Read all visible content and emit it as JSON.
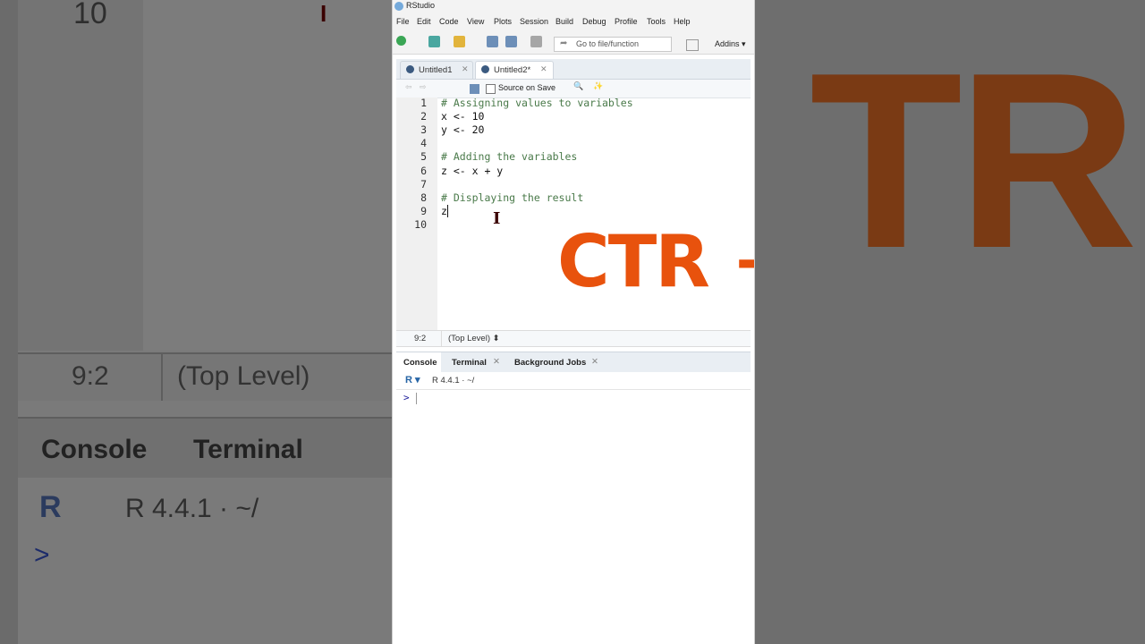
{
  "window": {
    "title": "RStudio"
  },
  "menu": [
    "File",
    "Edit",
    "Code",
    "View",
    "Plots",
    "Session",
    "Build",
    "Debug",
    "Profile",
    "Tools",
    "Help"
  ],
  "toolbar": {
    "goto_placeholder": "Go to file/function",
    "addins_label": "Addins"
  },
  "editor": {
    "tabs": [
      {
        "label": "Untitled1"
      },
      {
        "label": "Untitled2*"
      }
    ],
    "source_on_save": "Source on Save",
    "lines": [
      {
        "n": "1",
        "text": "# Assigning values to variables",
        "kind": "comment"
      },
      {
        "n": "2",
        "text": "x <- 10",
        "kind": "code"
      },
      {
        "n": "3",
        "text": "y <- 20",
        "kind": "code"
      },
      {
        "n": "4",
        "text": "",
        "kind": "code"
      },
      {
        "n": "5",
        "text": "# Adding the variables",
        "kind": "comment"
      },
      {
        "n": "6",
        "text": "z <- x + y",
        "kind": "code"
      },
      {
        "n": "7",
        "text": "",
        "kind": "code"
      },
      {
        "n": "8",
        "text": "# Displaying the result",
        "kind": "comment"
      },
      {
        "n": "9",
        "text": "z",
        "kind": "code"
      },
      {
        "n": "10",
        "text": "",
        "kind": "code"
      }
    ],
    "status_position": "9:2",
    "status_level": "(Top Level)"
  },
  "overlay_text": "CTR +",
  "console": {
    "tabs": [
      {
        "label": "Console"
      },
      {
        "label": "Terminal"
      },
      {
        "label": "Background Jobs"
      }
    ],
    "r_version": "R 4.4.1 · ~/",
    "prompt": ">"
  },
  "background": {
    "line_number": "10",
    "status_position": "9:2",
    "status_level": "(Top Level)",
    "console_tab": "Console",
    "terminal_tab": "Terminal",
    "r_version": "R 4.4.1 · ~/",
    "prompt": ">",
    "big_text": "TR +"
  },
  "colors": {
    "accent": "#e8520d",
    "comment": "#4a7a4a",
    "number": "#1a1a9a"
  }
}
